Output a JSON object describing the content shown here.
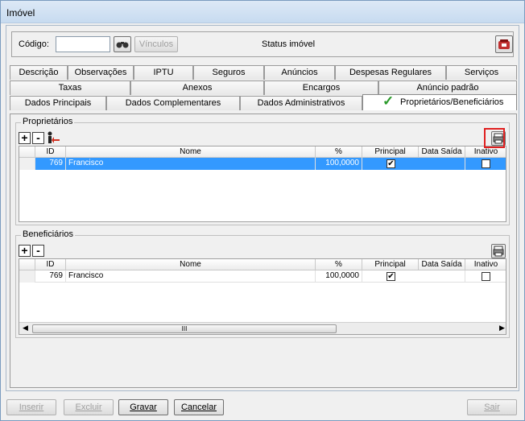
{
  "window": {
    "title": "Imóvel"
  },
  "header": {
    "code_label": "Código:",
    "code_value": "",
    "vinculos_label": "Vínculos",
    "status_label": "Status imóvel"
  },
  "tabs": {
    "row1": [
      "Descrição",
      "Observações",
      "IPTU",
      "Seguros",
      "Anúncios",
      "Despesas Regulares",
      "Serviços"
    ],
    "row2": [
      "Taxas",
      "Anexos",
      "Encargos",
      "Anúncio padrão"
    ],
    "row3": [
      "Dados Principais",
      "Dados Complementares",
      "Dados Administrativos",
      "Proprietários/Beneficiários"
    ],
    "active_checkmark": "✓"
  },
  "proprietarios": {
    "title": "Proprietários",
    "add": "+",
    "remove": "-",
    "columns": [
      "ID",
      "Nome",
      "%",
      "Principal",
      "Data Saída",
      "Inativo"
    ],
    "rows": [
      {
        "id": "769",
        "nome": "Francisco",
        "pct": "100,0000",
        "principal": true,
        "data_saida": "",
        "inativo": false
      }
    ]
  },
  "beneficiarios": {
    "title": "Beneficiários",
    "add": "+",
    "remove": "-",
    "columns": [
      "ID",
      "Nome",
      "%",
      "Principal",
      "Data Saída",
      "Inativo"
    ],
    "rows": [
      {
        "id": "769",
        "nome": "Francisco",
        "pct": "100,0000",
        "principal": true,
        "data_saida": "",
        "inativo": false
      }
    ],
    "scroll_thumb": "III"
  },
  "buttons": {
    "inserir": "Inserir",
    "excluir": "Excluir",
    "gravar": "Gravar",
    "cancelar": "Cancelar",
    "sair": "Sair"
  },
  "colors": {
    "selection": "#3399ff",
    "highlight_box": "#e02020",
    "checkmark": "#2a9a2a"
  }
}
